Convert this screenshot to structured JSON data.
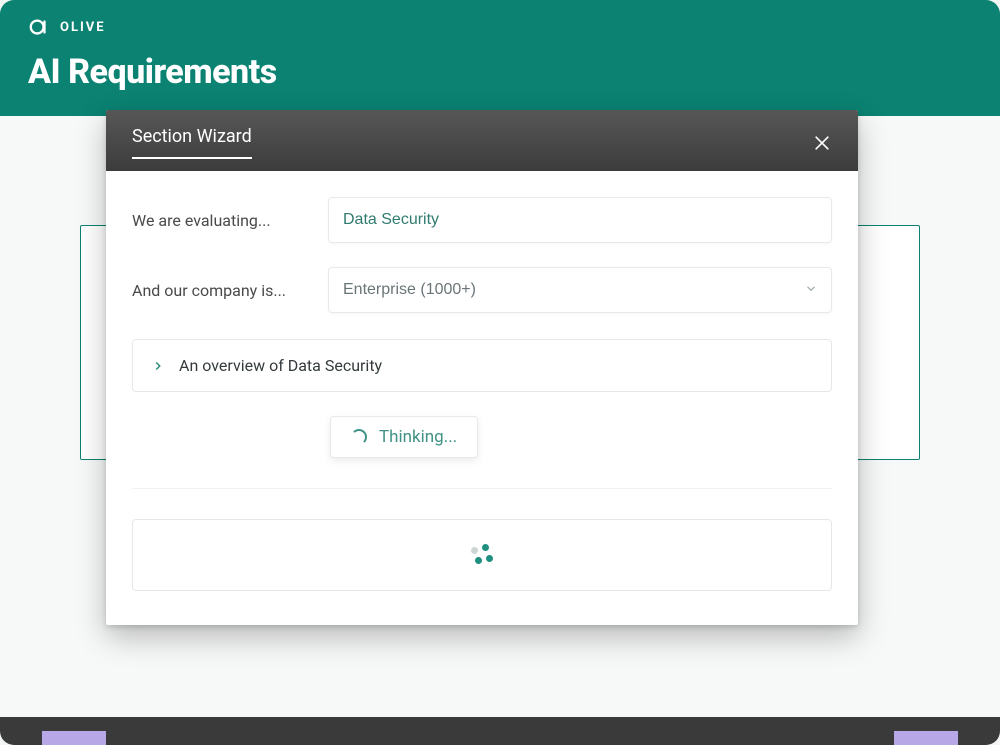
{
  "brand": {
    "name": "OLIVE"
  },
  "page": {
    "title": "AI Requirements"
  },
  "modal": {
    "title": "Section Wizard",
    "evaluating_label": "We are evaluating...",
    "evaluating_value": "Data Security",
    "company_label": "And our company is...",
    "company_value": "Enterprise (1000+)",
    "overview_label": "An overview of Data Security",
    "thinking_label": "Thinking..."
  }
}
